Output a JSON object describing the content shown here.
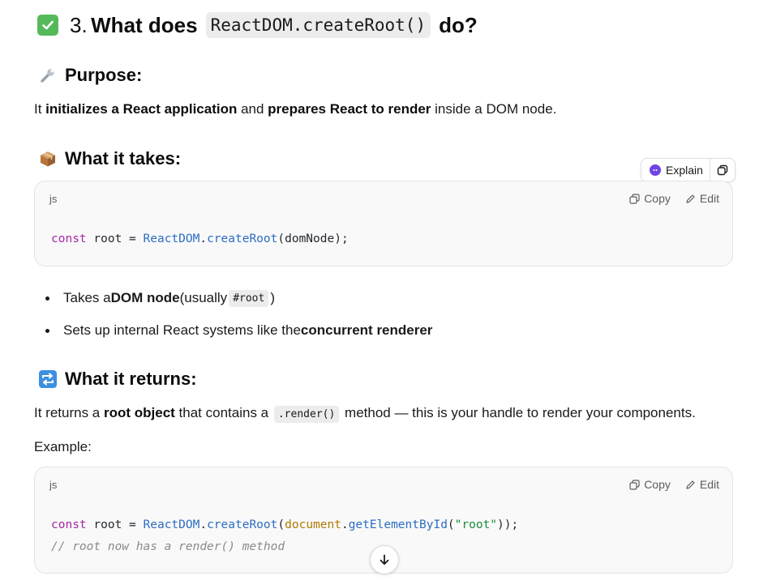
{
  "title": {
    "number": "3.",
    "bold_prefix": "What does",
    "code": "ReactDOM.createRoot()",
    "bold_suffix": "do?"
  },
  "purpose": {
    "heading": "Purpose:",
    "icon": "wrench-icon",
    "text_1": "It ",
    "bold_1": "initializes a React application",
    "text_2": " and ",
    "bold_2": "prepares React to render",
    "text_3": " inside a DOM node."
  },
  "takes": {
    "heading": "What it takes:",
    "icon": "package-icon"
  },
  "explain_pill": {
    "label": "Explain"
  },
  "code_block_1": {
    "lang": "js",
    "copy_label": "Copy",
    "edit_label": "Edit",
    "line": {
      "kw": "const",
      "var": " root = ",
      "cls": "ReactDOM",
      "dot": ".",
      "fn": "createRoot",
      "rest": "(domNode);"
    }
  },
  "bullets": [
    {
      "pre": "Takes a ",
      "bold": "DOM node",
      "mid": " (usually ",
      "code": "#root",
      "post": ")"
    },
    {
      "pre": "Sets up internal React systems like the ",
      "bold": "concurrent renderer"
    }
  ],
  "returns": {
    "heading": "What it returns:",
    "icon": "repeat-icon",
    "text_1": "It returns a ",
    "bold_1": "root object",
    "text_2": " that contains a ",
    "code": ".render()",
    "text_3": " method — this is your handle to render your components.",
    "example_label": "Example:"
  },
  "code_block_2": {
    "lang": "js",
    "copy_label": "Copy",
    "edit_label": "Edit",
    "line1": {
      "kw": "const",
      "var": " root = ",
      "cls": "ReactDOM",
      "dot1": ".",
      "fn1": "createRoot",
      "p1": "(",
      "obj": "document",
      "dot2": ".",
      "fn2": "getElementById",
      "p2": "(",
      "str": "\"root\"",
      "p3": "));"
    },
    "line2": "// root now has a render() method"
  },
  "colors": {
    "check_green": "#55b95a",
    "keyword": "#a626a4",
    "class_fn": "#2b6cc4",
    "string": "#1a8a3a",
    "comment": "#8a8a8a",
    "explain_accent": "#6e45e2"
  }
}
